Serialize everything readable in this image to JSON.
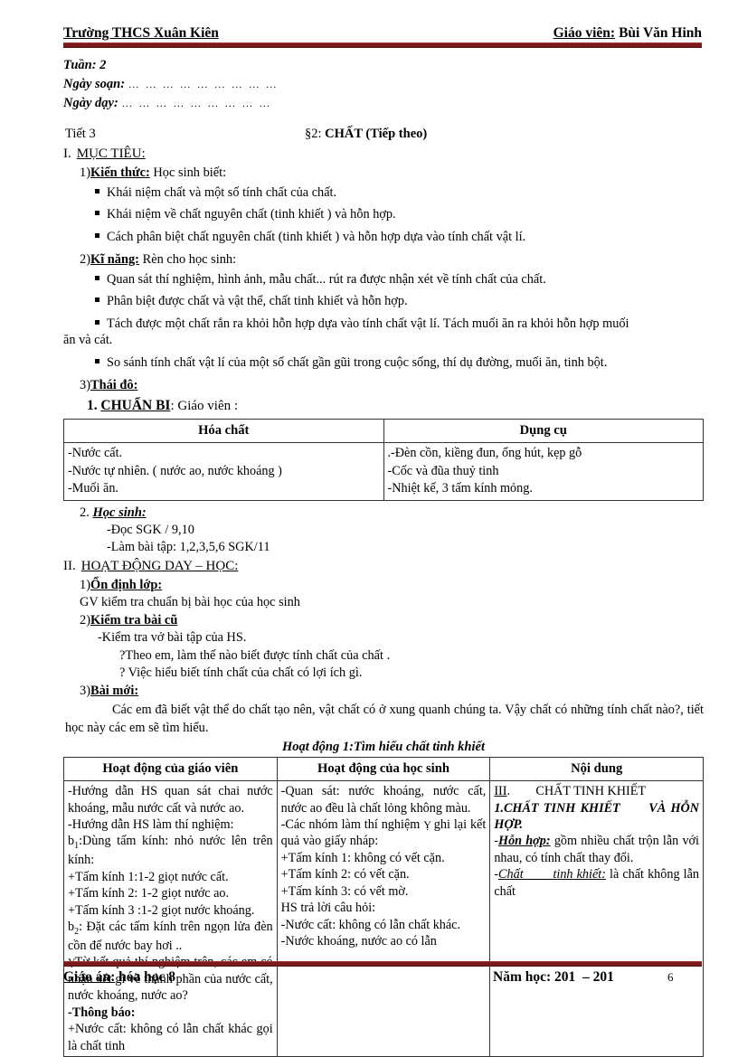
{
  "header": {
    "left": "Trường THCS Xuân Kiên",
    "right_label": "Giáo viên:",
    "right_name": "Bùi Văn Hinh"
  },
  "footer": {
    "left_label": "Giáo án:",
    "left_value": "hóa học 8",
    "center": "Năm học: 201  – 201",
    "page": "6"
  },
  "meta": {
    "tuan": "Tuần: 2",
    "ngay_soan_label": "Ngày soạn:",
    "ngay_soan_dots": "… … … … … … … … …",
    "ngay_day_label": "Ngày dạy:",
    "ngay_day_dots": "… … … … … … … … …"
  },
  "lesson": {
    "tiet": "Tiết 3",
    "section_mark": "§2:",
    "title": "CHẤT (Tiếp theo)"
  },
  "objectives": {
    "roman": "I.",
    "heading": "MỤC TIÊU:",
    "kien_thuc": {
      "num": "1)",
      "label": "Kiến thức:",
      "intro": "Học sinh biết:",
      "items": [
        "Khái niệm chất và một số tính chất của chất.",
        "Khái niệm về chất nguyên chất (tinh khiết ) và hỗn hợp.",
        "Cách phân biệt chất nguyên chất (tinh khiết ) và hỗn hợp dựa vào tính chất vật lí."
      ]
    },
    "ki_nang": {
      "num": "2)",
      "label": "Kĩ năng:",
      "intro": "Rèn cho học sinh:",
      "items": [
        "Quan sát thí nghiệm, hình ảnh, mẫu chất... rút ra được nhận xét về tính chất của chất.",
        "Phân biệt được chất và vật thể, chất tinh khiết và hỗn hợp.",
        "Tách được một chất rắn ra khỏi hỗn hợp dựa vào tính chất vật lí. Tách muối ăn ra khỏi hỗn hợp muối",
        "So sánh tính chất vật lí của một số chất gần gũi trong cuộc sống, thí dụ đường, muối ăn, tinh bột."
      ],
      "hang_line": "ăn và cát."
    },
    "thai_do": {
      "num": "3)",
      "label": "Thái đô:"
    }
  },
  "preparation": {
    "num": "1.",
    "label": "CHUẨN BI",
    "suffix": ": Giáo viên :",
    "table": {
      "headers": [
        "Hóa chất",
        "Dụng cụ"
      ],
      "rows": [
        {
          "col1": [
            "-Nước cất.",
            "-Nước tự nhiên.  ( nước ao, nước khoáng  )",
            "-Muối ăn."
          ],
          "col2": [
            ".-Đèn cồn, kiềng  đun, ống hút, kẹp gỗ",
            "-Cốc và đũa thuỷ tinh",
            "-Nhiệt kế, 3 tấm kính  mỏng."
          ]
        }
      ]
    },
    "hoc_sinh": {
      "num": "2.",
      "label": "Học sinh:",
      "lines": [
        "-Đọc SGK / 9,10",
        "-Làm bài tập: 1,2,3,5,6 SGK/11"
      ]
    }
  },
  "activities": {
    "roman": "II.",
    "heading": "HOẠT ĐỘNG DAY – HỌC:",
    "on_dinh": {
      "num": "1)",
      "label": "Ổn định lớp:",
      "line": "GV kiểm tra chuẩn bị bài học của học sinh"
    },
    "kiem_tra": {
      "num": "2)",
      "label": "Kiểm tra bài cũ",
      "lines": [
        "-Kiểm tra vở bài tập của HS.",
        "?Theo em, làm thế nào biết được tính chất của chất .",
        "? Việc hiểu biết tính chất của chất có lợi ích gì."
      ]
    },
    "bai_moi": {
      "num": "3)",
      "label": "Bài mới:",
      "para": "Các em đã biết vật thể do chất tạo nên, vật chất có ở xung quanh chúng ta. Vậy chất có những tính chất nào?, tiết học này các em sẽ tìm hiểu."
    },
    "activity_title": "Hoạt động 1:Tìm hiểu chất tinh khiết",
    "table": {
      "headers": [
        "Hoạt động của giáo viên",
        "Hoạt động của học sinh",
        "Nội dung"
      ],
      "teacher": [
        "-Hướng dẫn HS quan sát chai nước khoáng, mẫu nước cất và nước ao.",
        "-Hướng dẫn HS làm thí nghiệm:",
        "b1:Dùng tấm kính: nhỏ nước lên trên kính:",
        "+Tấm kính 1:1-2 giọt nước cất.",
        "+Tấm kính 2: 1-2 giọt nước ao.",
        "+Tấm kính 3 :1-2 giọt nước khoáng.",
        "b2: Đặt các tấm kính trên ngọn lửa đèn cồn để nước bay hơi ..",
        "Từ kết quả thí nghiệm  trên, các em có nhận xét gì về thành phần của nước cất, nước khoáng, nước ao?",
        "-Thông báo:",
        "+Nước cất: không có lẫn chất khác gọi là chất tinh"
      ],
      "student": [
        "-Quan sát: nước khoáng, nước cất, nước ao đều là chất lỏng không màu.",
        "-Các nhóm làm thí nghiệm     ghi lại kết quả vào giấy nháp:",
        "+Tấm kính 1: không có vết cặn.",
        "+Tấm kính 2: có vết cặn.",
        "+Tấm kính 3: có vết mờ.",
        "HS trả lời câu hỏi:",
        "-Nước cất: không có lẫn chất khác.",
        "-Nước khoáng, nước ao có lẫn"
      ],
      "content": [
        "III.        CHẤT TINH KHIẾT",
        "1.CHẤT TINH KHIẾT      VÀ HỖN HỢP.",
        "-Hỗn hợp: gồm nhiều chất trộn lẫn với nhau, có tính chất thay đổi.",
        "-Chất tinh khiết: là chất không lẫn chất"
      ]
    }
  },
  "colors": {
    "rule": "#7b1a1a",
    "text": "#000000"
  }
}
